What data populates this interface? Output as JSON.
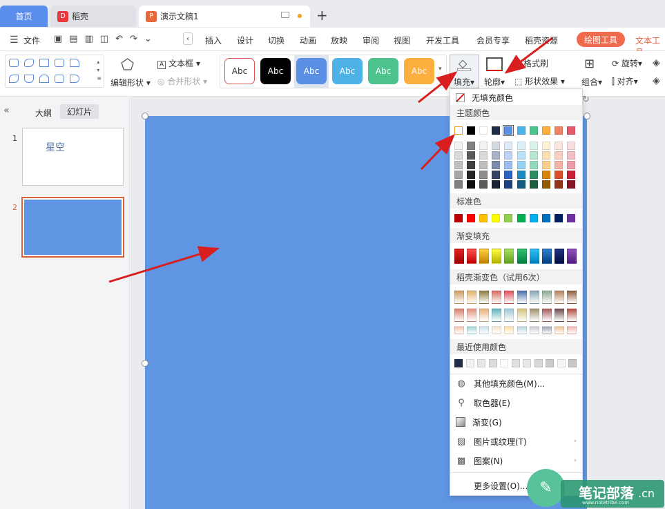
{
  "tabs": {
    "home": "首页",
    "daoke": "稻壳",
    "doc": "演示文稿1"
  },
  "menu": {
    "file": "文件",
    "items": [
      "插入",
      "设计",
      "切换",
      "动画",
      "放映",
      "审阅",
      "视图",
      "开发工具",
      "会员专享",
      "稻壳资源"
    ],
    "drawing_tools": "绘图工具",
    "text_tools": "文本工具"
  },
  "ribbon": {
    "edit_shape": "编辑形状",
    "text_box": "文本框",
    "merge_shape": "合并形状",
    "styles": [
      "Abc",
      "Abc",
      "Abc",
      "Abc",
      "Abc",
      "Abc"
    ],
    "fill": "填充",
    "outline": "轮廓",
    "format_painter": "格式刷",
    "shape_effect": "形状效果",
    "group": "组合",
    "rotate": "旋转",
    "align": "对齐"
  },
  "panel": {
    "outline_tab": "大纲",
    "slides_tab": "幻灯片",
    "thumbs": [
      {
        "num": "1",
        "title": "星空"
      },
      {
        "num": "2",
        "title": ""
      }
    ]
  },
  "dropdown": {
    "no_fill": "无填充颜色",
    "theme_colors": "主题颜色",
    "standard_colors": "标准色",
    "gradient_fill": "渐变填充",
    "daoke_gradient": "稻壳渐变色（试用6次）",
    "recent_colors": "最近使用颜色",
    "more_fill": "其他填充颜色(M)...",
    "picker": "取色器(E)",
    "gradient": "渐变(G)",
    "picture_texture": "图片或纹理(T)",
    "pattern": "图案(N)",
    "more_settings": "更多设置(O)..."
  },
  "colors": {
    "theme_top": [
      "#ffffff",
      "#000000",
      "#ffffff",
      "#1f2d46",
      "#5b8fe4",
      "#4fb2e6",
      "#4dc28d",
      "#fcae3f",
      "#ee8366",
      "#e65a6b"
    ],
    "theme_cols": [
      [
        "#f2f2f2",
        "#d9d9d9",
        "#bfbfbf",
        "#a6a6a6",
        "#7f7f7f"
      ],
      [
        "#7f7f7f",
        "#595959",
        "#3f3f3f",
        "#262626",
        "#0d0d0d"
      ],
      [
        "#f2f2f2",
        "#d9d9d9",
        "#bfbfbf",
        "#8c8c8c",
        "#595959"
      ],
      [
        "#d3d8e2",
        "#a8b2c7",
        "#7c8cab",
        "#34435f",
        "#1b2331"
      ],
      [
        "#dee8fa",
        "#bdd2f4",
        "#9cbcef",
        "#2c62c2",
        "#1d4181"
      ],
      [
        "#dcf0fa",
        "#b9e1f5",
        "#95d1f0",
        "#1d8ac1",
        "#135c81"
      ],
      [
        "#dbf3e8",
        "#b8e7d1",
        "#94daba",
        "#2a8d60",
        "#1c5e40"
      ],
      [
        "#fff0da",
        "#fee0b5",
        "#fdd08f",
        "#d88607",
        "#905904"
      ],
      [
        "#fce6e0",
        "#f8cdc2",
        "#f5b4a3",
        "#d94f27",
        "#91351a"
      ],
      [
        "#fadee1",
        "#f5bdc4",
        "#f09ca6",
        "#c92034",
        "#861623"
      ]
    ],
    "standard": [
      "#c00000",
      "#ff0000",
      "#ffc000",
      "#ffff00",
      "#92d050",
      "#00b050",
      "#00b0f0",
      "#0070c0",
      "#002060",
      "#7030a0"
    ],
    "gradients": [
      [
        "#e02020",
        "#a00000"
      ],
      [
        "#ff5050",
        "#c00000"
      ],
      [
        "#ffd040",
        "#c08000"
      ],
      [
        "#ffff40",
        "#b0b000"
      ],
      [
        "#a8e060",
        "#60a020"
      ],
      [
        "#30c070",
        "#008040"
      ],
      [
        "#30c0f0",
        "#0080c0"
      ],
      [
        "#3080d0",
        "#004080"
      ],
      [
        "#203080",
        "#001040"
      ],
      [
        "#9050c0",
        "#502080"
      ]
    ],
    "daoke": [
      [
        "#c99a5b",
        "#e0b06b",
        "#8c7a3a",
        "#d6665c",
        "#e04a5a",
        "#4a6da8",
        "#87a2b4",
        "#8aa88a",
        "#b27e56",
        "#8c5a3a"
      ],
      [
        "#d67c6a",
        "#e08f79",
        "#e8b078",
        "#5fb1b9",
        "#9cc7d4",
        "#d4c37a",
        "#9d8f6a",
        "#a35a5a",
        "#6a4a4a",
        "#b24a3a"
      ],
      [
        "#f2c1b0",
        "#9ad3d8",
        "#c9e0ec",
        "#f4e4d0",
        "#f9e0a0",
        "#b9d4e0",
        "#c8c9d2",
        "#9aa4b0",
        "#f0c090",
        "#f4b0a8"
      ]
    ],
    "recent": [
      "#1f2d46",
      "#f2f2f2",
      "#e6e6e6",
      "#dcdcdc",
      "#ffffff",
      "#e0e0e0",
      "#e8e8e8",
      "#d8d8d8",
      "#cccccc",
      "#f5f5f5",
      "#c8c8c8"
    ],
    "slide_fill": "#6095e3",
    "accent": "#f06b4d"
  },
  "watermark": {
    "text": "笔记部落",
    "url": "www.notetribe.com",
    "suffix": ".cn"
  }
}
